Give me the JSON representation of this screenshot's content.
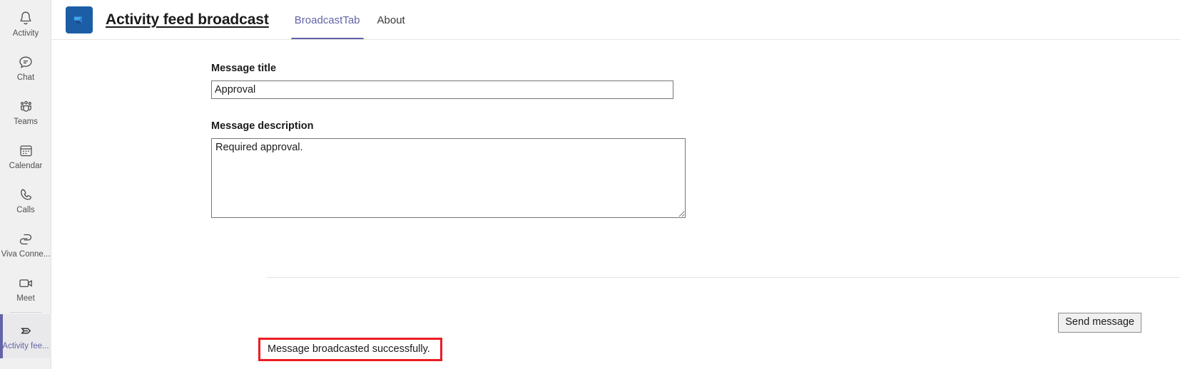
{
  "rail": {
    "items": [
      {
        "label": "Activity",
        "icon": "bell-icon",
        "active": false
      },
      {
        "label": "Chat",
        "icon": "chat-icon",
        "active": false
      },
      {
        "label": "Teams",
        "icon": "teams-icon",
        "active": false
      },
      {
        "label": "Calendar",
        "icon": "calendar-icon",
        "active": false
      },
      {
        "label": "Calls",
        "icon": "phone-icon",
        "active": false
      },
      {
        "label": "Viva Conne...",
        "icon": "viva-connections-icon",
        "active": false
      },
      {
        "label": "Meet",
        "icon": "video-camera-icon",
        "active": false
      },
      {
        "label": "Activity fee...",
        "icon": "broadcast-icon",
        "active": true
      }
    ]
  },
  "header": {
    "app_icon": "activity-feed-broadcast-app-icon",
    "title": "Activity feed broadcast",
    "tabs": [
      {
        "label": "BroadcastTab",
        "active": true
      },
      {
        "label": "About",
        "active": false
      }
    ]
  },
  "form": {
    "title_label": "Message title",
    "title_value": "Approval",
    "title_placeholder": "",
    "description_label": "Message description",
    "description_value": "Required approval.",
    "description_placeholder": "",
    "send_button_label": "Send message"
  },
  "status": {
    "message": "Message broadcasted successfully."
  },
  "colors": {
    "accent_purple": "#6264a7",
    "app_icon_blue": "#1b5ea6",
    "highlight_red": "#ec1c24",
    "rail_background": "#f0f0f0"
  }
}
